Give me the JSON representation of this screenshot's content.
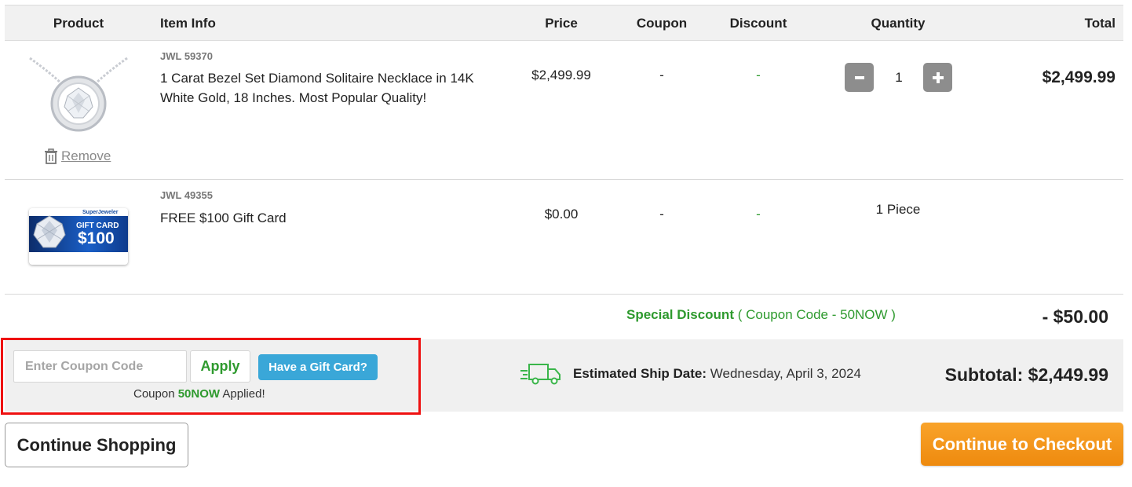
{
  "table": {
    "headers": {
      "product": "Product",
      "item_info": "Item Info",
      "price": "Price",
      "coupon": "Coupon",
      "discount": "Discount",
      "quantity": "Quantity",
      "total": "Total"
    }
  },
  "items": [
    {
      "sku": "JWL 59370",
      "title_line1": "1 Carat Bezel Set Diamond Solitaire Necklace in 14K",
      "title_line2": "White Gold, 18 Inches. Most Popular Quality!",
      "price": "$2,499.99",
      "coupon": "-",
      "discount": "-",
      "quantity": "1",
      "total": "$2,499.99",
      "remove_label": "Remove"
    },
    {
      "sku": "JWL 49355",
      "title": "FREE $100 Gift Card",
      "price": "$0.00",
      "coupon": "-",
      "discount": "-",
      "quantity": "1 Piece",
      "gift_card_brand": "SuperJeweler",
      "gift_card_label": "GIFT CARD",
      "gift_card_amount": "$100"
    }
  ],
  "special_discount": {
    "label": "Special Discount",
    "code_text": "( Coupon Code - 50NOW )",
    "amount": "- $50.00"
  },
  "coupon_form": {
    "placeholder": "Enter Coupon Code",
    "apply_label": "Apply",
    "gift_card_label": "Have a Gift Card?",
    "status_prefix": "Coupon",
    "status_code": "50NOW",
    "status_suffix": "Applied!"
  },
  "shipping": {
    "label": "Estimated Ship Date:",
    "date": "Wednesday, April 3, 2024"
  },
  "subtotal": {
    "label": "Subtotal:",
    "amount": "$2,449.99"
  },
  "actions": {
    "continue_shopping": "Continue Shopping",
    "checkout": "Continue to Checkout"
  },
  "colors": {
    "accent_green": "#2e9a2e",
    "gift_button": "#3aa7d8",
    "checkout_orange": "#f39a1e",
    "highlight_red": "#ee1111"
  }
}
